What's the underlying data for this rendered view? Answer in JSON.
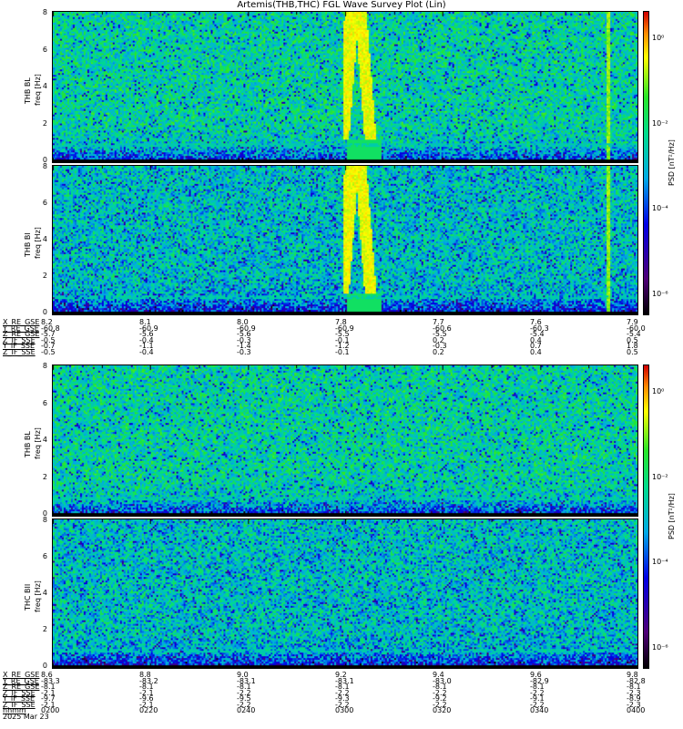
{
  "chart_data": {
    "type": "heatmap",
    "title": "Artemis(THB,THC) FGL Wave Survey Plot (Lin)",
    "colorbar": {
      "label": "PSD [nT²/Hz]",
      "ticks": [
        "10⁰",
        "10⁻²",
        "10⁻⁴",
        "10⁻⁶"
      ],
      "tick_exponents": [
        0,
        -2,
        -4,
        -6
      ],
      "colormap": "rainbow"
    },
    "yaxis": {
      "label": "freq [Hz]",
      "range": [
        0,
        8
      ],
      "ticks": [
        "0",
        "2",
        "4",
        "6",
        "8"
      ]
    },
    "xaxis": {
      "range": [
        "0200",
        "0400"
      ]
    },
    "panels": [
      {
        "name": "THB BL",
        "event": true
      },
      {
        "name": "THB BI",
        "event": true
      },
      {
        "name": "THB BL",
        "event": false
      },
      {
        "name": "THC BII",
        "event": false
      }
    ],
    "ephemeris_top": {
      "rows": [
        {
          "name": "X_RE_GSE",
          "values": [
            "8.2",
            "8.1",
            "8.0",
            "7.8",
            "7.7",
            "7.6",
            "7.9"
          ]
        },
        {
          "name": "Y_RE_GSE",
          "values": [
            "-60.8",
            "-60.9",
            "-60.9",
            "-60.9",
            "-60.6",
            "-60.3",
            "-60.0"
          ]
        },
        {
          "name": "Z_RE_GSE",
          "values": [
            "-5.7",
            "-5.6",
            "-5.6",
            "-5.5",
            "-5.5",
            "-5.4",
            "-5.4"
          ]
        },
        {
          "name": "Z_IF_SSE",
          "values": [
            "-0.5",
            "-0.4",
            "-0.3",
            "-0.1",
            "0.2",
            "0.4",
            "0.5"
          ]
        },
        {
          "name": "Y_IF_SSE",
          "values": [
            "-0.7",
            "-1.1",
            "-1.4",
            "-1.2",
            "-0.3",
            "0.7",
            "1.8"
          ]
        },
        {
          "name": "Z_IF_SSE",
          "values": [
            "-0.5",
            "-0.4",
            "-0.3",
            "-0.1",
            "0.2",
            "0.4",
            "0.5"
          ]
        }
      ]
    },
    "ephemeris_bottom": {
      "rows": [
        {
          "name": "X_RE_GSE",
          "values": [
            "8.6",
            "8.8",
            "9.0",
            "9.2",
            "9.4",
            "9.6",
            "9.8"
          ]
        },
        {
          "name": "Y_RE_GSE",
          "values": [
            "-83.3",
            "-83.2",
            "-83.1",
            "-83.1",
            "-83.0",
            "-82.9",
            "-82.8"
          ]
        },
        {
          "name": "Z_RE_GSE",
          "values": [
            "-8.1",
            "-8.1",
            "-8.1",
            "-8.1",
            "-8.1",
            "-8.1",
            "-8.1"
          ]
        },
        {
          "name": "Z_IF_SSE",
          "values": [
            "-2.1",
            "-2.1",
            "-2.2",
            "-2.2",
            "-2.2",
            "-2.2",
            "-2.3"
          ]
        },
        {
          "name": "Y_IF_SSE",
          "values": [
            "-9.7",
            "-9.6",
            "-9.5",
            "-9.3",
            "-9.2",
            "-9.1",
            "-8.9"
          ]
        },
        {
          "name": "Z_IF_SSE",
          "values": [
            "-2.1",
            "-2.1",
            "-2.2",
            "-2.2",
            "-2.2",
            "-2.2",
            "-2.3"
          ]
        },
        {
          "name": "hhmm",
          "values": [
            "0200",
            "0220",
            "0240",
            "0300",
            "0320",
            "0340",
            "0400"
          ]
        }
      ],
      "date": "2025 Mar 23"
    }
  }
}
